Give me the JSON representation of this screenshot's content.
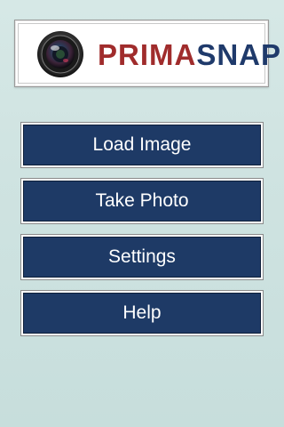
{
  "logo": {
    "text_part1": "PRIMA",
    "text_part2": "SNAP",
    "icon": "camera-lens-icon"
  },
  "menu": {
    "load_image": "Load Image",
    "take_photo": "Take Photo",
    "settings": "Settings",
    "help": "Help"
  },
  "colors": {
    "background": "#cfe3e1",
    "button_fill": "#1e3a66",
    "logo_red": "#a02c2c",
    "logo_blue": "#1f3a6b"
  }
}
